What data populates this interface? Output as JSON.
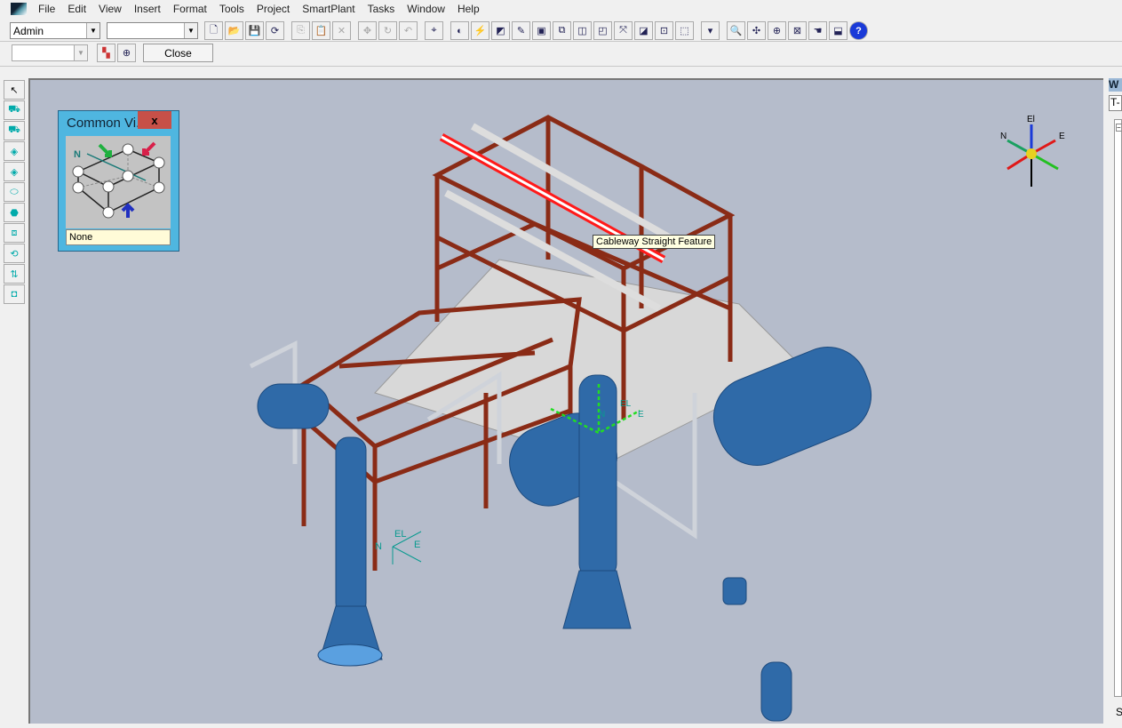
{
  "menubar": {
    "items": [
      "File",
      "Edit",
      "View",
      "Insert",
      "Format",
      "Tools",
      "Project",
      "SmartPlant",
      "Tasks",
      "Window",
      "Help"
    ]
  },
  "toolbar1": {
    "user_combo": "Admin",
    "filter_combo": "",
    "buttons": [
      {
        "name": "new",
        "glyph": "🗋"
      },
      {
        "name": "open",
        "glyph": "📂"
      },
      {
        "name": "save",
        "glyph": "💾"
      },
      {
        "name": "refresh",
        "glyph": "⟳"
      },
      {
        "name": "copy",
        "glyph": "⎘",
        "disabled": true
      },
      {
        "name": "paste",
        "glyph": "📋",
        "disabled": true
      },
      {
        "name": "delete",
        "glyph": "✕",
        "disabled": true
      },
      {
        "name": "move",
        "glyph": "✥",
        "disabled": true
      },
      {
        "name": "rotate",
        "glyph": "↻",
        "disabled": true
      },
      {
        "name": "undo",
        "glyph": "↶",
        "disabled": true
      },
      {
        "name": "coordinates",
        "glyph": "⌖"
      },
      {
        "name": "measure",
        "glyph": "◐"
      },
      {
        "name": "check-interference",
        "glyph": "⚡"
      },
      {
        "name": "properties",
        "glyph": "◩"
      },
      {
        "name": "pencil",
        "glyph": "✎"
      },
      {
        "name": "view-3d",
        "glyph": "▣"
      },
      {
        "name": "copy-view",
        "glyph": "⧉"
      },
      {
        "name": "clip",
        "glyph": "◫"
      },
      {
        "name": "camera",
        "glyph": "◰"
      },
      {
        "name": "fit",
        "glyph": "⤧"
      },
      {
        "name": "clip-plane",
        "glyph": "◪"
      },
      {
        "name": "section",
        "glyph": "⊡"
      },
      {
        "name": "select-box",
        "glyph": "⬚"
      },
      {
        "name": "dropdown",
        "glyph": "▾"
      },
      {
        "name": "zoom",
        "glyph": "🔍"
      },
      {
        "name": "pan",
        "glyph": "✣"
      },
      {
        "name": "zoom-area",
        "glyph": "⊕"
      },
      {
        "name": "fit-all",
        "glyph": "⊠"
      },
      {
        "name": "navigate",
        "glyph": "☚"
      },
      {
        "name": "previous-view",
        "glyph": "⬓"
      },
      {
        "name": "help",
        "glyph": "?"
      }
    ]
  },
  "toolbar2": {
    "combo": "",
    "close_label": "Close"
  },
  "left_toolbar": {
    "tools": [
      {
        "name": "select",
        "glyph": "↖"
      },
      {
        "name": "place-equipment",
        "glyph": "⛟"
      },
      {
        "name": "place-nozzle",
        "glyph": "⛟"
      },
      {
        "name": "place-feature",
        "glyph": "◈"
      },
      {
        "name": "place-route",
        "glyph": "◈"
      },
      {
        "name": "cylinder",
        "glyph": "⬭"
      },
      {
        "name": "place-part",
        "glyph": "⬣"
      },
      {
        "name": "insert-shape",
        "glyph": "⧈"
      },
      {
        "name": "rotate-object",
        "glyph": "⟲"
      },
      {
        "name": "move-connect",
        "glyph": "⇅"
      },
      {
        "name": "solid",
        "glyph": "◘"
      }
    ]
  },
  "common_views": {
    "title": "Common Vi...",
    "north_label": "N",
    "selection": "None"
  },
  "viewport": {
    "tooltip": "Cableway Straight Feature",
    "compass": {
      "el": "El",
      "n": "N",
      "e": "E"
    },
    "local_axes": [
      {
        "n": "N",
        "el": "EL",
        "e": "E"
      },
      {
        "n": "N",
        "el": "EL",
        "e": "E"
      }
    ],
    "colors": {
      "background": "#b5bccb",
      "steel": "#8a2b16",
      "vessel": "#2f6aa8",
      "highlight": "#ff1a1a"
    }
  },
  "right_panel": {
    "title": "W",
    "combo": "T-",
    "tree_expander": "−",
    "status": "S"
  }
}
